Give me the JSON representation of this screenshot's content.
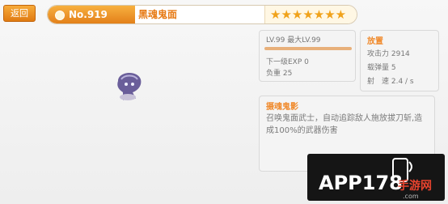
{
  "header": {
    "back_label": "返回",
    "number": "No.919",
    "name": "黑魂鬼面",
    "stars": "★★★★★★★",
    "star_rating": 7
  },
  "level_panel": {
    "level_text": "LV.99 最大LV.99",
    "level_progress": 1.0,
    "next_exp": "下一级EXP 0",
    "load": "负重 25"
  },
  "stats_panel": {
    "title": "放置",
    "attack": "攻击力 2914",
    "ammo": "载弹量 5",
    "rate": "射　速 2.4 / s"
  },
  "skill_panel": {
    "title": "摄魂鬼影",
    "description": "召唤鬼面武士，自动追踪敌人施放拔刀斩,造成100%的武器伤害"
  },
  "colors": {
    "accent": "#e77b16",
    "star": "#f0a21b",
    "section_title": "#f08a2c"
  },
  "watermark": {
    "brand": "APP178",
    "suffix": "手游网",
    "domain": ".com"
  }
}
